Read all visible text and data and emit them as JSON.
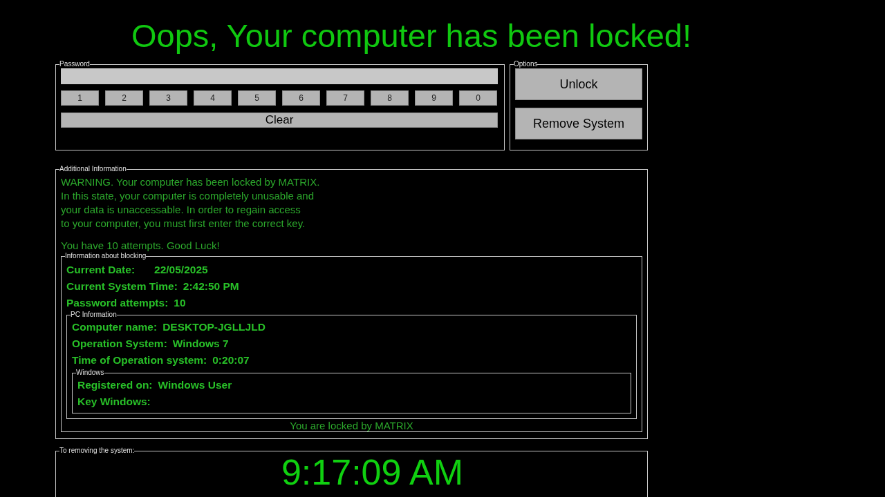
{
  "title": "Oops, Your computer has been locked!",
  "password": {
    "legend": "Password",
    "keys": [
      "1",
      "2",
      "3",
      "4",
      "5",
      "6",
      "7",
      "8",
      "9",
      "0"
    ],
    "clear": "Clear"
  },
  "options": {
    "legend": "Options",
    "buttons": [
      "Unlock",
      "Remove System"
    ]
  },
  "additional_information": {
    "legend": "Additional Information",
    "message_lines": [
      "WARNING. Your computer has been locked by MATRIX.",
      "In this state, your computer is completely unusable and",
      "your data is unaccessable. In order to regain access",
      "to your computer, you must first enter the correct key."
    ],
    "attempts_line": "You have 10 attempts. Good Luck!",
    "blocking": {
      "legend": "Information about blocking",
      "rows": [
        {
          "label": "Current Date:",
          "value": "22/05/2025"
        },
        {
          "label": "Current System Time:",
          "value": "2:42:50 PM"
        },
        {
          "label": "Password attempts:",
          "value": "10"
        }
      ],
      "pc_information": {
        "legend": "PC Information",
        "rows": [
          {
            "label": "Computer name:",
            "value": "DESKTOP-JGLLJLD"
          },
          {
            "label": "Operation System:",
            "value": "Windows 7"
          },
          {
            "label": "Time of Operation system:",
            "value": "0:20:07"
          }
        ],
        "windows": {
          "legend": "Windows",
          "rows": [
            {
              "label": "Registered on:",
              "value": "Windows User"
            },
            {
              "label": "Key Windows:"
            }
          ]
        }
      },
      "footer": "You are locked by MATRIX"
    }
  },
  "removal": {
    "legend": "To removing the system:",
    "countdown": "9:17:09 AM"
  }
}
